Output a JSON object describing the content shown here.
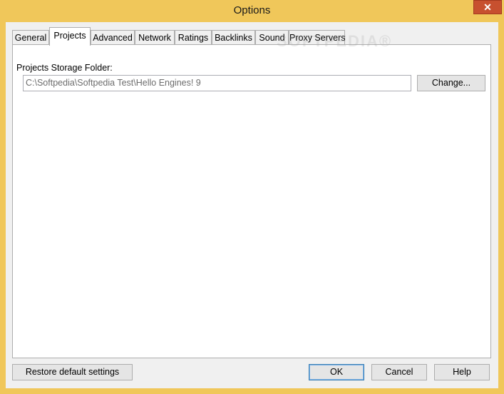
{
  "window": {
    "title": "Options",
    "close_glyph": "✕"
  },
  "tabs": [
    {
      "label": "General",
      "active": false
    },
    {
      "label": "Projects",
      "active": true
    },
    {
      "label": "Advanced",
      "active": false
    },
    {
      "label": "Network",
      "active": false
    },
    {
      "label": "Ratings",
      "active": false
    },
    {
      "label": "Backlinks",
      "active": false
    },
    {
      "label": "Sound",
      "active": false
    },
    {
      "label": "Proxy Servers",
      "active": false
    }
  ],
  "projects": {
    "folder_label": "Projects Storage Folder:",
    "folder_value": "C:\\Softpedia\\Softpedia Test\\Hello Engines! 9",
    "change_label": "Change..."
  },
  "footer": {
    "restore_label": "Restore default settings",
    "ok_label": "OK",
    "cancel_label": "Cancel",
    "help_label": "Help"
  },
  "watermark": "SOFTPEDIA®",
  "colors": {
    "frame": "#f0c75a",
    "close_button": "#c7502f",
    "dialog_bg": "#f0f0f0"
  }
}
